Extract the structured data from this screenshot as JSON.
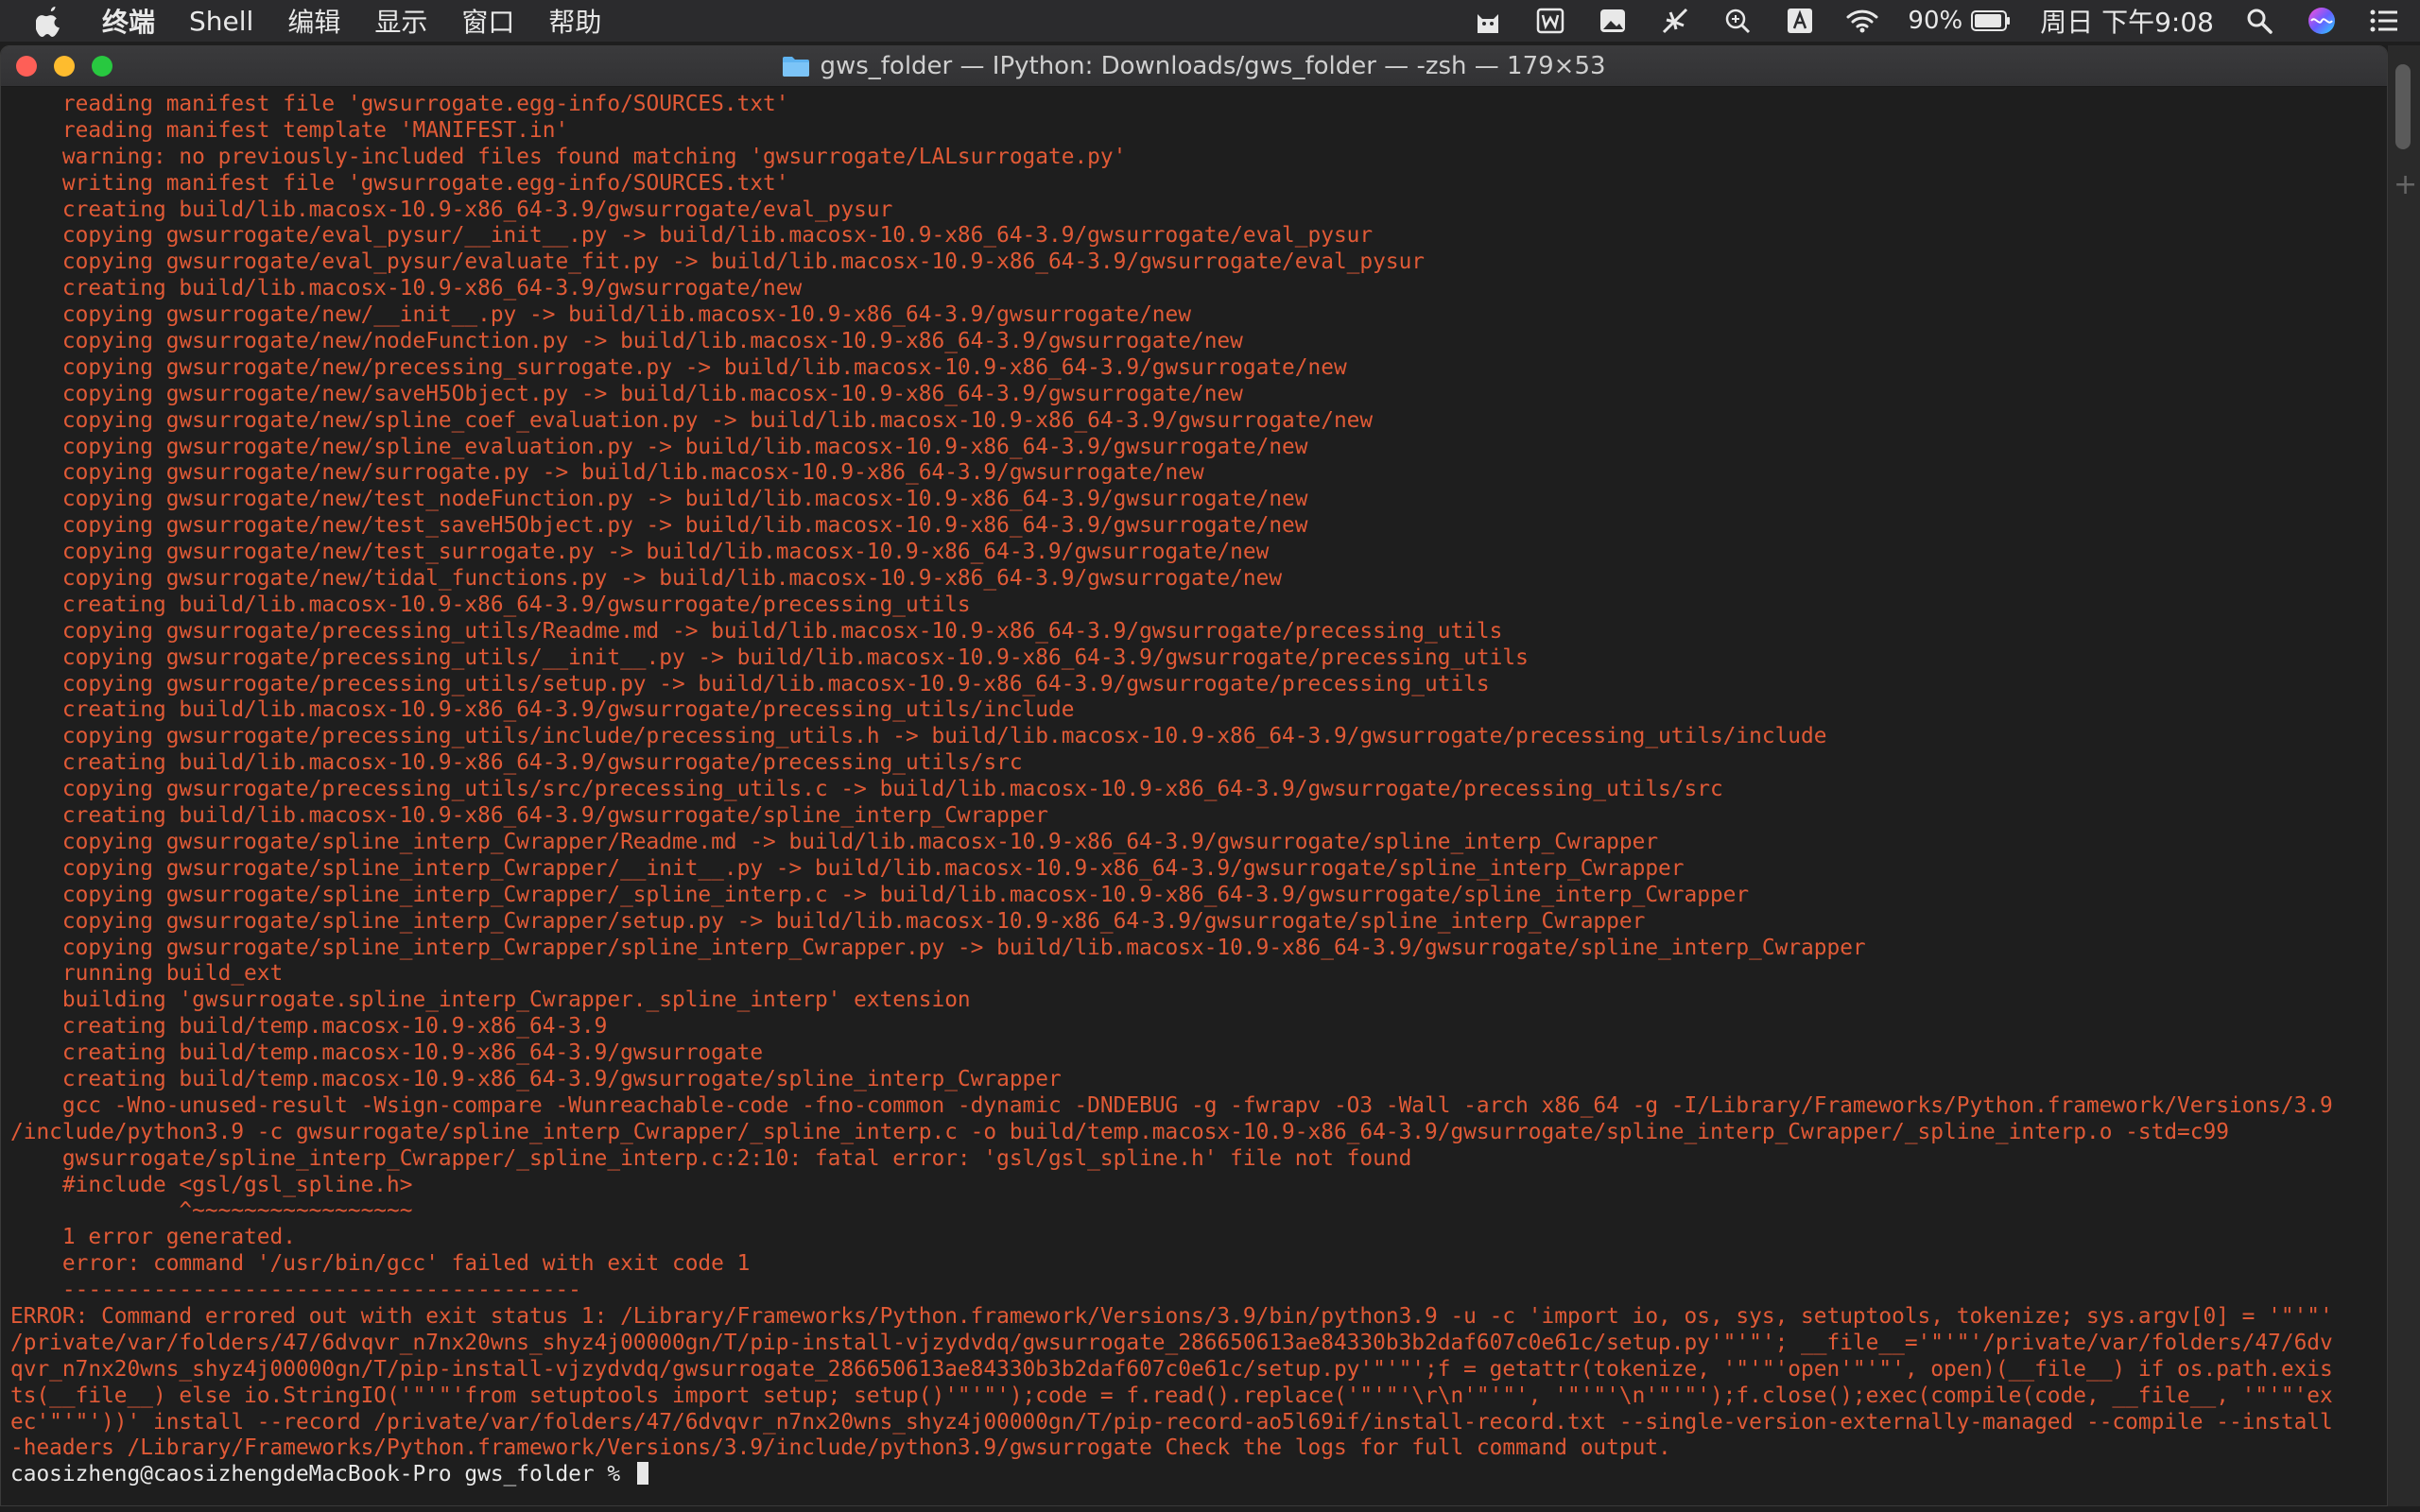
{
  "menubar": {
    "app_name": "终端",
    "items": [
      "Shell",
      "编辑",
      "显示",
      "窗口",
      "帮助"
    ],
    "battery": "90%",
    "clock": "周日 下午9:08",
    "status_icons": [
      "cat-icon",
      "word-icon",
      "image-icon",
      "feather-icon",
      "search-q-icon",
      "font-a-icon",
      "wifi-icon",
      "battery-icon",
      "spotlight-icon",
      "siri-icon",
      "control-center-icon"
    ]
  },
  "window": {
    "title": "gws_folder — IPython: Downloads/gws_folder — -zsh — 179×53"
  },
  "terminal": {
    "lines": [
      "    reading manifest file 'gwsurrogate.egg-info/SOURCES.txt'",
      "    reading manifest template 'MANIFEST.in'",
      "    warning: no previously-included files found matching 'gwsurrogate/LALsurrogate.py'",
      "    writing manifest file 'gwsurrogate.egg-info/SOURCES.txt'",
      "    creating build/lib.macosx-10.9-x86_64-3.9/gwsurrogate/eval_pysur",
      "    copying gwsurrogate/eval_pysur/__init__.py -> build/lib.macosx-10.9-x86_64-3.9/gwsurrogate/eval_pysur",
      "    copying gwsurrogate/eval_pysur/evaluate_fit.py -> build/lib.macosx-10.9-x86_64-3.9/gwsurrogate/eval_pysur",
      "    creating build/lib.macosx-10.9-x86_64-3.9/gwsurrogate/new",
      "    copying gwsurrogate/new/__init__.py -> build/lib.macosx-10.9-x86_64-3.9/gwsurrogate/new",
      "    copying gwsurrogate/new/nodeFunction.py -> build/lib.macosx-10.9-x86_64-3.9/gwsurrogate/new",
      "    copying gwsurrogate/new/precessing_surrogate.py -> build/lib.macosx-10.9-x86_64-3.9/gwsurrogate/new",
      "    copying gwsurrogate/new/saveH5Object.py -> build/lib.macosx-10.9-x86_64-3.9/gwsurrogate/new",
      "    copying gwsurrogate/new/spline_coef_evaluation.py -> build/lib.macosx-10.9-x86_64-3.9/gwsurrogate/new",
      "    copying gwsurrogate/new/spline_evaluation.py -> build/lib.macosx-10.9-x86_64-3.9/gwsurrogate/new",
      "    copying gwsurrogate/new/surrogate.py -> build/lib.macosx-10.9-x86_64-3.9/gwsurrogate/new",
      "    copying gwsurrogate/new/test_nodeFunction.py -> build/lib.macosx-10.9-x86_64-3.9/gwsurrogate/new",
      "    copying gwsurrogate/new/test_saveH5Object.py -> build/lib.macosx-10.9-x86_64-3.9/gwsurrogate/new",
      "    copying gwsurrogate/new/test_surrogate.py -> build/lib.macosx-10.9-x86_64-3.9/gwsurrogate/new",
      "    copying gwsurrogate/new/tidal_functions.py -> build/lib.macosx-10.9-x86_64-3.9/gwsurrogate/new",
      "    creating build/lib.macosx-10.9-x86_64-3.9/gwsurrogate/precessing_utils",
      "    copying gwsurrogate/precessing_utils/Readme.md -> build/lib.macosx-10.9-x86_64-3.9/gwsurrogate/precessing_utils",
      "    copying gwsurrogate/precessing_utils/__init__.py -> build/lib.macosx-10.9-x86_64-3.9/gwsurrogate/precessing_utils",
      "    copying gwsurrogate/precessing_utils/setup.py -> build/lib.macosx-10.9-x86_64-3.9/gwsurrogate/precessing_utils",
      "    creating build/lib.macosx-10.9-x86_64-3.9/gwsurrogate/precessing_utils/include",
      "    copying gwsurrogate/precessing_utils/include/precessing_utils.h -> build/lib.macosx-10.9-x86_64-3.9/gwsurrogate/precessing_utils/include",
      "    creating build/lib.macosx-10.9-x86_64-3.9/gwsurrogate/precessing_utils/src",
      "    copying gwsurrogate/precessing_utils/src/precessing_utils.c -> build/lib.macosx-10.9-x86_64-3.9/gwsurrogate/precessing_utils/src",
      "    creating build/lib.macosx-10.9-x86_64-3.9/gwsurrogate/spline_interp_Cwrapper",
      "    copying gwsurrogate/spline_interp_Cwrapper/Readme.md -> build/lib.macosx-10.9-x86_64-3.9/gwsurrogate/spline_interp_Cwrapper",
      "    copying gwsurrogate/spline_interp_Cwrapper/__init__.py -> build/lib.macosx-10.9-x86_64-3.9/gwsurrogate/spline_interp_Cwrapper",
      "    copying gwsurrogate/spline_interp_Cwrapper/_spline_interp.c -> build/lib.macosx-10.9-x86_64-3.9/gwsurrogate/spline_interp_Cwrapper",
      "    copying gwsurrogate/spline_interp_Cwrapper/setup.py -> build/lib.macosx-10.9-x86_64-3.9/gwsurrogate/spline_interp_Cwrapper",
      "    copying gwsurrogate/spline_interp_Cwrapper/spline_interp_Cwrapper.py -> build/lib.macosx-10.9-x86_64-3.9/gwsurrogate/spline_interp_Cwrapper",
      "    running build_ext",
      "    building 'gwsurrogate.spline_interp_Cwrapper._spline_interp' extension",
      "    creating build/temp.macosx-10.9-x86_64-3.9",
      "    creating build/temp.macosx-10.9-x86_64-3.9/gwsurrogate",
      "    creating build/temp.macosx-10.9-x86_64-3.9/gwsurrogate/spline_interp_Cwrapper",
      "    gcc -Wno-unused-result -Wsign-compare -Wunreachable-code -fno-common -dynamic -DNDEBUG -g -fwrapv -O3 -Wall -arch x86_64 -g -I/Library/Frameworks/Python.framework/Versions/3.9",
      "/include/python3.9 -c gwsurrogate/spline_interp_Cwrapper/_spline_interp.c -o build/temp.macosx-10.9-x86_64-3.9/gwsurrogate/spline_interp_Cwrapper/_spline_interp.o -std=c99",
      "    gwsurrogate/spline_interp_Cwrapper/_spline_interp.c:2:10: fatal error: 'gsl/gsl_spline.h' file not found",
      "    #include <gsl/gsl_spline.h>",
      "             ^~~~~~~~~~~~~~~~~~",
      "    1 error generated.",
      "    error: command '/usr/bin/gcc' failed with exit code 1",
      "    ----------------------------------------",
      "ERROR: Command errored out with exit status 1: /Library/Frameworks/Python.framework/Versions/3.9/bin/python3.9 -u -c 'import io, os, sys, setuptools, tokenize; sys.argv[0] = '\"'\"'",
      "/private/var/folders/47/6dvqvr_n7nx20wns_shyz4j00000gn/T/pip-install-vjzydvdq/gwsurrogate_286650613ae84330b3b2daf607c0e61c/setup.py'\"'\"'; __file__='\"'\"'/private/var/folders/47/6dv",
      "qvr_n7nx20wns_shyz4j00000gn/T/pip-install-vjzydvdq/gwsurrogate_286650613ae84330b3b2daf607c0e61c/setup.py'\"'\"';f = getattr(tokenize, '\"'\"'open'\"'\"', open)(__file__) if os.path.exis",
      "ts(__file__) else io.StringIO('\"'\"'from setuptools import setup; setup()'\"'\"');code = f.read().replace('\"'\"'\\r\\n'\"'\"', '\"'\"'\\n'\"'\"');f.close();exec(compile(code, __file__, '\"'\"'ex",
      "ec'\"'\"'))' install --record /private/var/folders/47/6dvqvr_n7nx20wns_shyz4j00000gn/T/pip-record-ao5l69if/install-record.txt --single-version-externally-managed --compile --install",
      "-headers /Library/Frameworks/Python.framework/Versions/3.9/include/python3.9/gwsurrogate Check the logs for full command output."
    ],
    "prompt": "caosizheng@caosizhengdeMacBook-Pro gws_folder % "
  }
}
